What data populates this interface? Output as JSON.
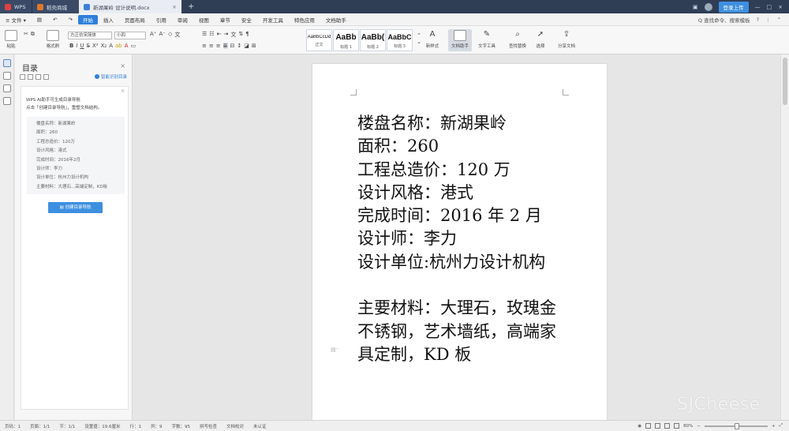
{
  "titlebar": {
    "tabs": [
      {
        "label": "WPS"
      },
      {
        "label": "稻壳商城"
      },
      {
        "label": "新湖果岭 设计说明.docx"
      }
    ],
    "plus": "+",
    "login": "登录上传"
  },
  "menu": {
    "file": "≡ 文件 ▾",
    "items": [
      "开始",
      "插入",
      "页面布局",
      "引用",
      "审阅",
      "视图",
      "章节",
      "安全",
      "开发工具",
      "特色应用",
      "文档助手"
    ],
    "search": "Q 查找命令、搜索模板",
    "help": "?"
  },
  "ribbon": {
    "paste": "粘贴",
    "format_painter": "格式刷",
    "font_name": "方正仿宋简体",
    "font_size": "小四",
    "styles": [
      {
        "sample": "AaBbCcDd",
        "caption": "正文"
      },
      {
        "sample": "AaBb",
        "caption": "标题 1"
      },
      {
        "sample": "AaBb(",
        "caption": "标题 2"
      },
      {
        "sample": "AaBbC",
        "caption": "标题 3"
      }
    ],
    "new_style": "新样式",
    "doc_assistant": "文档助手",
    "text_tools": "文字工具",
    "find_replace": "查找替换",
    "select": "选择",
    "share": "分享文档"
  },
  "nav": {
    "title": "目录",
    "close": "×",
    "smart": "智能识别目录",
    "card_close": "×",
    "msg_line1": "WPS AI助手可生成目录导航",
    "msg_line2": "点击「创建目录导航」，重塑文档结构。",
    "info": [
      "楼盘名称：新湖果岭",
      "面积：260",
      "工程总造价：120万",
      "设计风格：港式",
      "完成时间：2016年2月",
      "设计师：李力",
      "设计单位：杭州力设计机构",
      "主要材料：大理石...高端定制，KD板"
    ],
    "button": "创建目录导航"
  },
  "document": {
    "lines": [
      "楼盘名称：新湖果岭",
      "面积：260",
      "工程总造价：120 万",
      "设计风格：港式",
      "完成时间：2016 年 2 月",
      "设计师：李力",
      "设计单位:杭州力设计机构",
      "",
      "主要材料：大理石，玫瑰金",
      "不锈钢，艺术墙纸，高端家",
      "具定制，KD 板"
    ]
  },
  "status": {
    "items": [
      "页码：1",
      "页面：1/1",
      "节：1/1",
      "设置值：19.6厘米",
      "行：1",
      "列：9",
      "字数：95",
      "拼写检查",
      "文档校对",
      "未认证"
    ],
    "zoom": "80%",
    "minus": "−",
    "plus": "+"
  },
  "watermark": "SJCheese"
}
